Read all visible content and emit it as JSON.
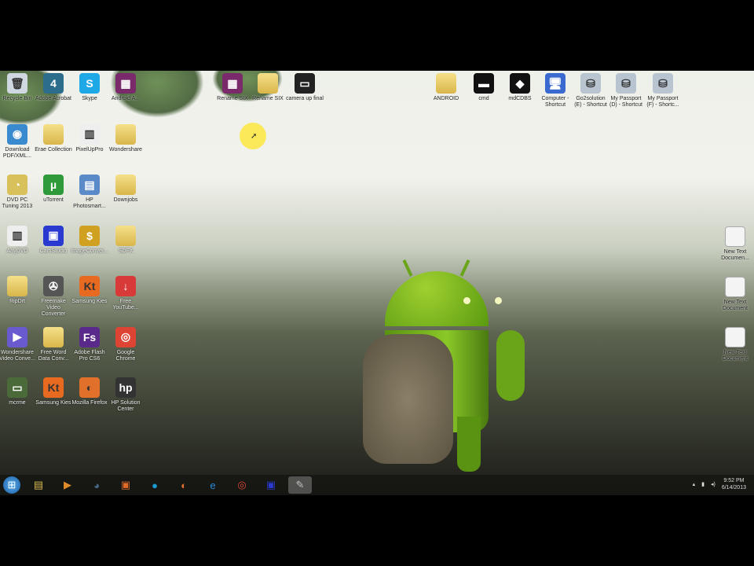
{
  "desktop_icons_left": [
    {
      "label": "Recycle Bin",
      "glyph": "🗑",
      "color": "#cfd8e0"
    },
    {
      "label": "Adobe Acrobat",
      "glyph": "4",
      "color": "#2b6d8a"
    },
    {
      "label": "Skype",
      "glyph": "S",
      "color": "#1fa8e6"
    },
    {
      "label": "Android A...",
      "glyph": "▦",
      "color": "#7a2a6a"
    },
    {
      "label": "Download PDF/XML...",
      "glyph": "◉",
      "color": "#3a8ad0"
    },
    {
      "label": "Erae Collection",
      "glyph": "",
      "color": "folder"
    },
    {
      "label": "PixelUpPro",
      "glyph": "▥",
      "color": "#eeeeee"
    },
    {
      "label": "Wondershare",
      "glyph": "",
      "color": "folder"
    },
    {
      "label": "DVD PC Tuning 2013",
      "glyph": "◔",
      "color": "#d8c05a"
    },
    {
      "label": "uTorrent",
      "glyph": "µ",
      "color": "#2e9a3a"
    },
    {
      "label": "HP Photosmart...",
      "glyph": "▤",
      "color": "#5a8ac8"
    },
    {
      "label": "Downjobs",
      "glyph": "",
      "color": "folder"
    },
    {
      "label": "AnyDVD",
      "glyph": "▥",
      "color": "#eeeeee"
    },
    {
      "label": "CamStudio",
      "glyph": "▣",
      "color": "#2a3ad0"
    },
    {
      "label": "ImageConver...",
      "glyph": "$",
      "color": "#d0a020"
    },
    {
      "label": "SDFX",
      "glyph": "",
      "color": "folder"
    },
    {
      "label": "RipDrt",
      "glyph": "",
      "color": "folder"
    },
    {
      "label": "Freemake Video Converter",
      "glyph": "✇",
      "color": "#555555"
    },
    {
      "label": "Samsung Kies",
      "glyph": "Kt",
      "color": "#e86a20"
    },
    {
      "label": "Free YouTube...",
      "glyph": "↓",
      "color": "#d83a3a"
    },
    {
      "label": "Wondershare Video Conve...",
      "glyph": "▶",
      "color": "#6a5ad0"
    },
    {
      "label": "Free Word Data Conv...",
      "glyph": "",
      "color": "folder"
    },
    {
      "label": "Adobe Flash Pro CS6",
      "glyph": "Fs",
      "color": "#5a2a8a"
    },
    {
      "label": "Google Chrome",
      "glyph": "◎",
      "color": "#dd4433"
    },
    {
      "label": "mcrme",
      "glyph": "▭",
      "color": "#4a6a3a"
    },
    {
      "label": "Samsung Kies",
      "glyph": "Kt",
      "color": "#e86a20"
    },
    {
      "label": "Mozilla Firefox",
      "glyph": "◐",
      "color": "#e0702a"
    },
    {
      "label": "HP Solution Center",
      "glyph": "hp",
      "color": "#333333"
    }
  ],
  "desktop_icons_top": [
    {
      "label": "Rename SIX",
      "glyph": "▦",
      "color": "#7a2a6a"
    },
    {
      "label": "Rename SIX",
      "glyph": "",
      "color": "folder"
    },
    {
      "label": "camera up final",
      "glyph": "▭",
      "color": "#222222"
    },
    {
      "label": "ANDROID",
      "glyph": "",
      "color": "folder"
    },
    {
      "label": "cmd",
      "glyph": "▬",
      "color": "#111111"
    },
    {
      "label": "mdCDBS",
      "glyph": "◆",
      "color": "#111111"
    },
    {
      "label": "Computer - Shortcut",
      "glyph": "🖥",
      "color": "#3a6ad0"
    },
    {
      "label": "Go2solution (E) - Shortcut",
      "glyph": "⛁",
      "color": "#b8c4d0"
    },
    {
      "label": "My Passport (D) - Shortcut",
      "glyph": "⛁",
      "color": "#b8c4d0"
    },
    {
      "label": "My Passport (F) - Shortc...",
      "glyph": "⛁",
      "color": "#b8c4d0"
    }
  ],
  "desktop_icons_right": [
    {
      "label": "New Text Documen..."
    },
    {
      "label": "New Text Document"
    },
    {
      "label": "New Text Document"
    }
  ],
  "taskbar": {
    "start": "⊞",
    "items": [
      {
        "name": "explorer",
        "glyph": "▤",
        "color": "#d8b850"
      },
      {
        "name": "media-player",
        "glyph": "▶",
        "color": "#e08a2a"
      },
      {
        "name": "app",
        "glyph": "◕",
        "color": "#4a6a8a"
      },
      {
        "name": "app2",
        "glyph": "▣",
        "color": "#e06a2a"
      },
      {
        "name": "app3",
        "glyph": "●",
        "color": "#1a9ad0"
      },
      {
        "name": "firefox",
        "glyph": "◐",
        "color": "#e0702a"
      },
      {
        "name": "internet-explorer",
        "glyph": "e",
        "color": "#2a8ad8"
      },
      {
        "name": "chrome",
        "glyph": "◎",
        "color": "#dd4433"
      },
      {
        "name": "camstudio",
        "glyph": "▣",
        "color": "#2a3ad0"
      },
      {
        "name": "paint",
        "glyph": "✎",
        "color": "#c0c0c0"
      }
    ],
    "time": "9:52 PM",
    "date": "6/14/2013"
  }
}
